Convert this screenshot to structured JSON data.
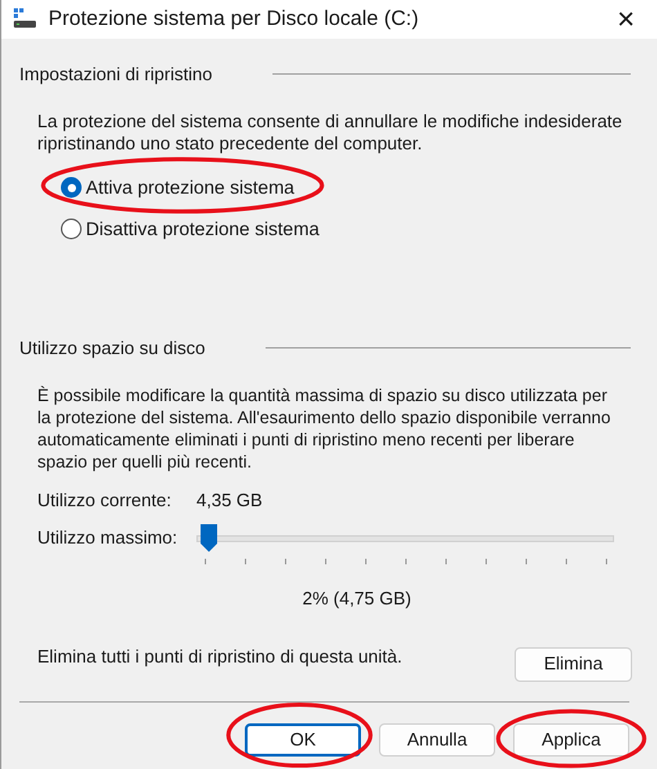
{
  "window": {
    "title": "Protezione sistema per Disco locale (C:)",
    "close": "×"
  },
  "restore_settings": {
    "heading": "Impostazioni di ripristino",
    "description": "La protezione del sistema consente di annullare le modifiche indesiderate ripristinando uno stato precedente del computer.",
    "options": [
      {
        "label": "Attiva protezione sistema",
        "selected": true
      },
      {
        "label": "Disattiva protezione sistema",
        "selected": false
      }
    ]
  },
  "disk_usage": {
    "heading": "Utilizzo spazio su disco",
    "description": "È possibile modificare la quantità massima di spazio su disco utilizzata per la protezione del sistema. All'esaurimento dello spazio disponibile verranno automaticamente eliminati i punti di ripristino meno recenti per liberare spazio per quelli più recenti.",
    "current_label": "Utilizzo corrente:",
    "current_value": "4,35 GB",
    "max_label": "Utilizzo massimo:",
    "max_slider": {
      "level": 0.02
    },
    "max_reading": "2% (4,75 GB)",
    "delete_text": "Elimina tutti i punti di ripristino di questa unità.",
    "delete_button": "Elimina"
  },
  "buttons": [
    {
      "label": "OK",
      "default": true
    },
    {
      "label": "Annulla",
      "default": false
    },
    {
      "label": "Applica",
      "default": false
    }
  ]
}
